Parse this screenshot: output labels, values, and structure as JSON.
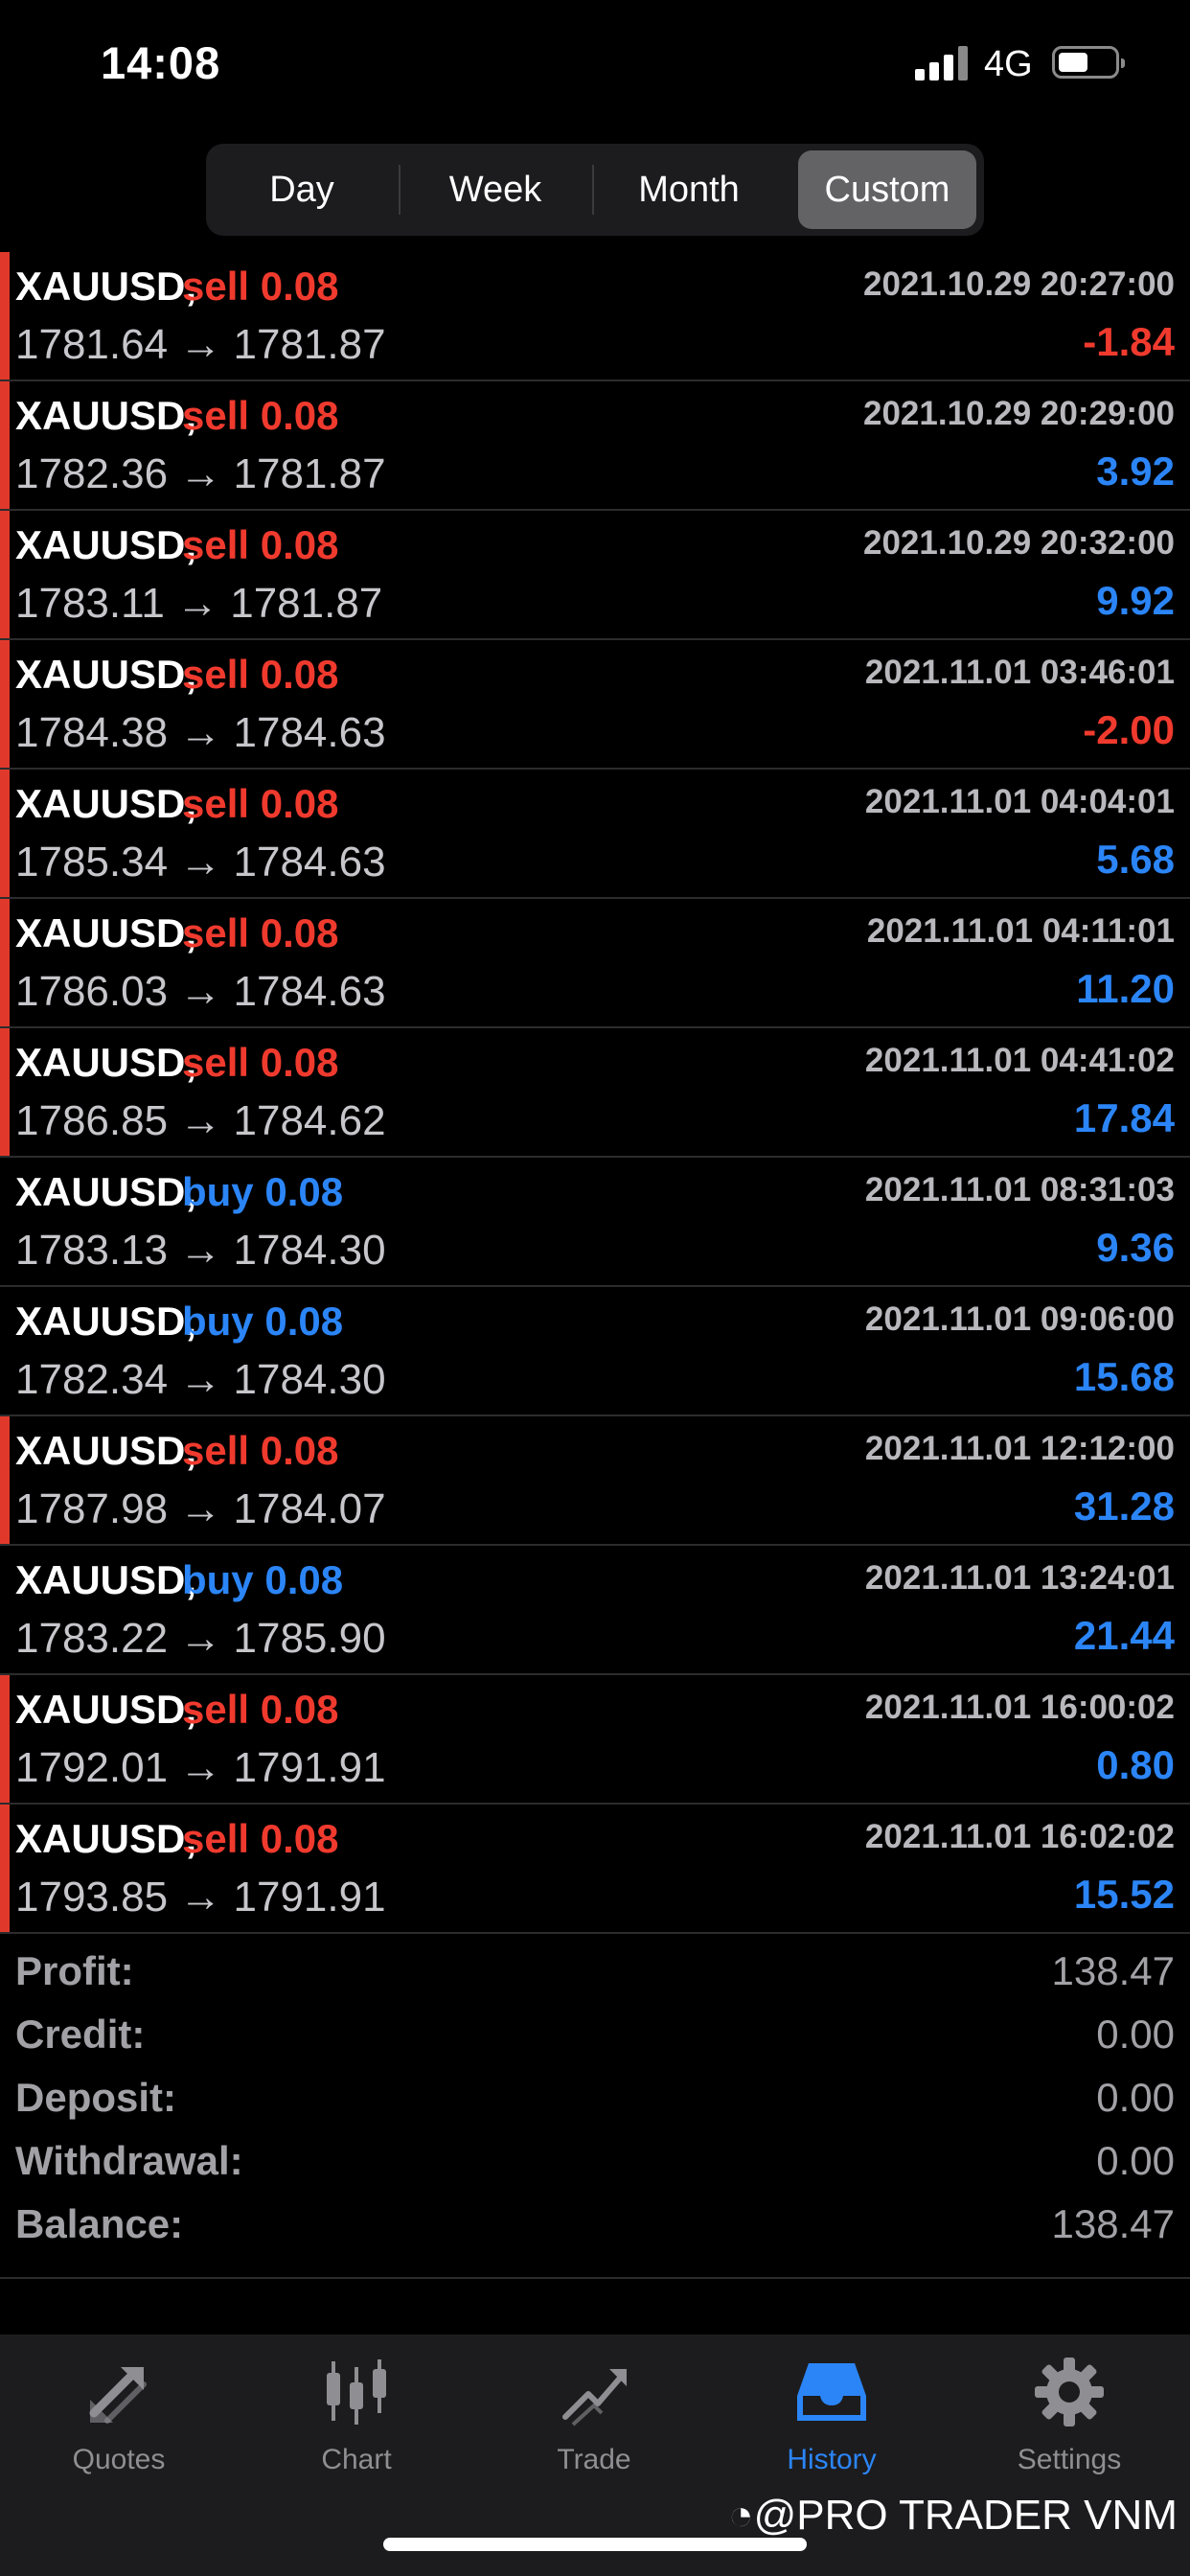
{
  "status": {
    "time": "14:08",
    "network": "4G"
  },
  "period_tabs": [
    "Day",
    "Week",
    "Month",
    "Custom"
  ],
  "active_tab": "Custom",
  "deals": [
    {
      "symbol": "XAUUSD,",
      "side": "sell 0.08",
      "type": "sell",
      "datetime": "2021.10.29 20:27:00",
      "prices": "1781.64 → 1781.87",
      "profit": "-1.84",
      "profit_sign": "neg"
    },
    {
      "symbol": "XAUUSD,",
      "side": "sell 0.08",
      "type": "sell",
      "datetime": "2021.10.29 20:29:00",
      "prices": "1782.36 → 1781.87",
      "profit": "3.92",
      "profit_sign": "pos"
    },
    {
      "symbol": "XAUUSD,",
      "side": "sell 0.08",
      "type": "sell",
      "datetime": "2021.10.29 20:32:00",
      "prices": "1783.11 → 1781.87",
      "profit": "9.92",
      "profit_sign": "pos"
    },
    {
      "symbol": "XAUUSD,",
      "side": "sell 0.08",
      "type": "sell",
      "datetime": "2021.11.01 03:46:01",
      "prices": "1784.38 → 1784.63",
      "profit": "-2.00",
      "profit_sign": "neg"
    },
    {
      "symbol": "XAUUSD,",
      "side": "sell 0.08",
      "type": "sell",
      "datetime": "2021.11.01 04:04:01",
      "prices": "1785.34 → 1784.63",
      "profit": "5.68",
      "profit_sign": "pos"
    },
    {
      "symbol": "XAUUSD,",
      "side": "sell 0.08",
      "type": "sell",
      "datetime": "2021.11.01 04:11:01",
      "prices": "1786.03 → 1784.63",
      "profit": "11.20",
      "profit_sign": "pos"
    },
    {
      "symbol": "XAUUSD,",
      "side": "sell 0.08",
      "type": "sell",
      "datetime": "2021.11.01 04:41:02",
      "prices": "1786.85 → 1784.62",
      "profit": "17.84",
      "profit_sign": "pos"
    },
    {
      "symbol": "XAUUSD,",
      "side": "buy 0.08",
      "type": "buy",
      "datetime": "2021.11.01 08:31:03",
      "prices": "1783.13 → 1784.30",
      "profit": "9.36",
      "profit_sign": "pos"
    },
    {
      "symbol": "XAUUSD,",
      "side": "buy 0.08",
      "type": "buy",
      "datetime": "2021.11.01 09:06:00",
      "prices": "1782.34 → 1784.30",
      "profit": "15.68",
      "profit_sign": "pos"
    },
    {
      "symbol": "XAUUSD,",
      "side": "sell 0.08",
      "type": "sell",
      "datetime": "2021.11.01 12:12:00",
      "prices": "1787.98 → 1784.07",
      "profit": "31.28",
      "profit_sign": "pos"
    },
    {
      "symbol": "XAUUSD,",
      "side": "buy 0.08",
      "type": "buy",
      "datetime": "2021.11.01 13:24:01",
      "prices": "1783.22 → 1785.90",
      "profit": "21.44",
      "profit_sign": "pos"
    },
    {
      "symbol": "XAUUSD,",
      "side": "sell 0.08",
      "type": "sell",
      "datetime": "2021.11.01 16:00:02",
      "prices": "1792.01 → 1791.91",
      "profit": "0.80",
      "profit_sign": "pos"
    },
    {
      "symbol": "XAUUSD,",
      "side": "sell 0.08",
      "type": "sell",
      "datetime": "2021.11.01 16:02:02",
      "prices": "1793.85 → 1791.91",
      "profit": "15.52",
      "profit_sign": "pos"
    }
  ],
  "summary": [
    {
      "label": "Profit:",
      "value": "138.47"
    },
    {
      "label": "Credit:",
      "value": "0.00"
    },
    {
      "label": "Deposit:",
      "value": "0.00"
    },
    {
      "label": "Withdrawal:",
      "value": "0.00"
    },
    {
      "label": "Balance:",
      "value": "138.47"
    }
  ],
  "tabbar": [
    {
      "label": "Quotes",
      "icon": "quotes-icon"
    },
    {
      "label": "Chart",
      "icon": "chart-icon"
    },
    {
      "label": "Trade",
      "icon": "trade-icon"
    },
    {
      "label": "History",
      "icon": "history-icon"
    },
    {
      "label": "Settings",
      "icon": "settings-icon"
    }
  ],
  "active_nav": "History",
  "watermark": "@PRO TRADER VNM",
  "colors": {
    "sell": "#f03a2e",
    "buy": "#2b85f7",
    "accent": "#2b85f7",
    "background": "#000000"
  }
}
